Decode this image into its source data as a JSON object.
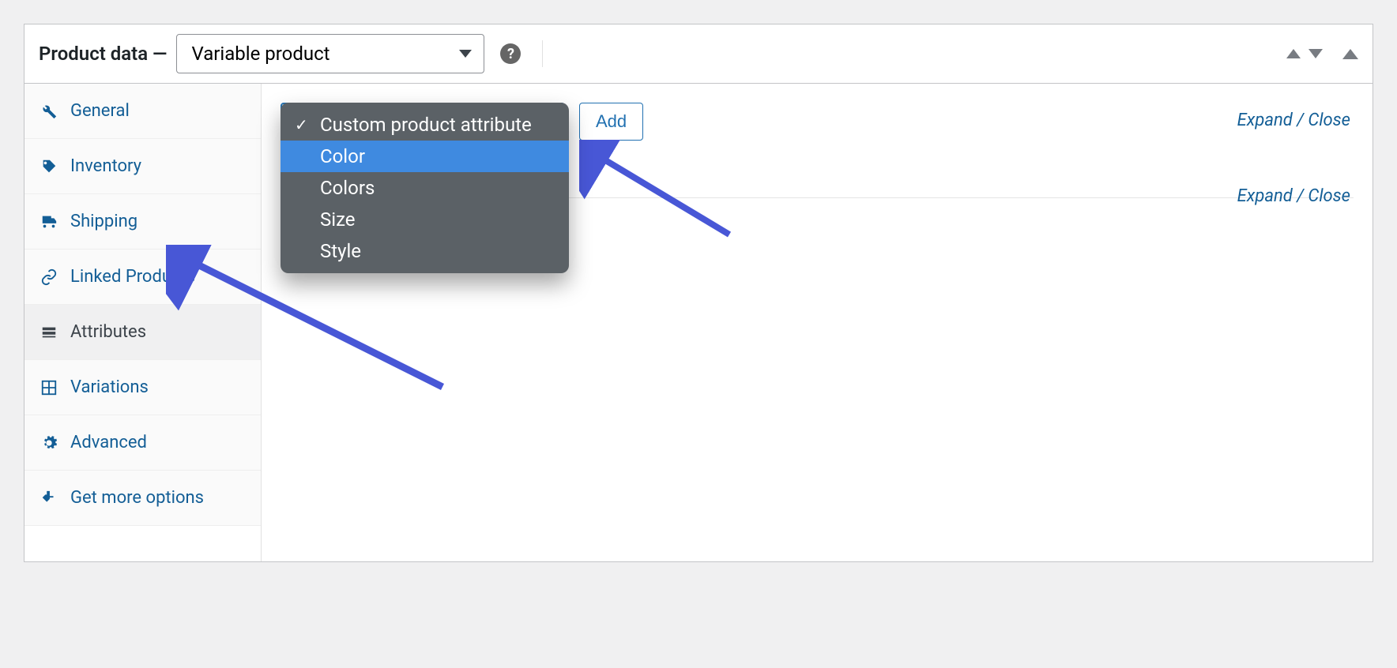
{
  "header": {
    "title_prefix": "Product data —",
    "product_type": "Variable product"
  },
  "tabs": [
    {
      "id": "general",
      "label": "General"
    },
    {
      "id": "inventory",
      "label": "Inventory"
    },
    {
      "id": "shipping",
      "label": "Shipping"
    },
    {
      "id": "linked",
      "label": "Linked Products"
    },
    {
      "id": "attributes",
      "label": "Attributes"
    },
    {
      "id": "variations",
      "label": "Variations"
    },
    {
      "id": "advanced",
      "label": "Advanced"
    },
    {
      "id": "getmore",
      "label": "Get more options"
    }
  ],
  "active_tab": "attributes",
  "content": {
    "dropdown_options": [
      {
        "label": "Custom product attribute",
        "checked": true,
        "highlight": false
      },
      {
        "label": "Color",
        "checked": false,
        "highlight": true
      },
      {
        "label": "Colors",
        "checked": false,
        "highlight": false
      },
      {
        "label": "Size",
        "checked": false,
        "highlight": false
      },
      {
        "label": "Style",
        "checked": false,
        "highlight": false
      }
    ],
    "add_button": "Add",
    "expand_close_1": "Expand / Close",
    "expand_close_2": "Expand / Close"
  }
}
